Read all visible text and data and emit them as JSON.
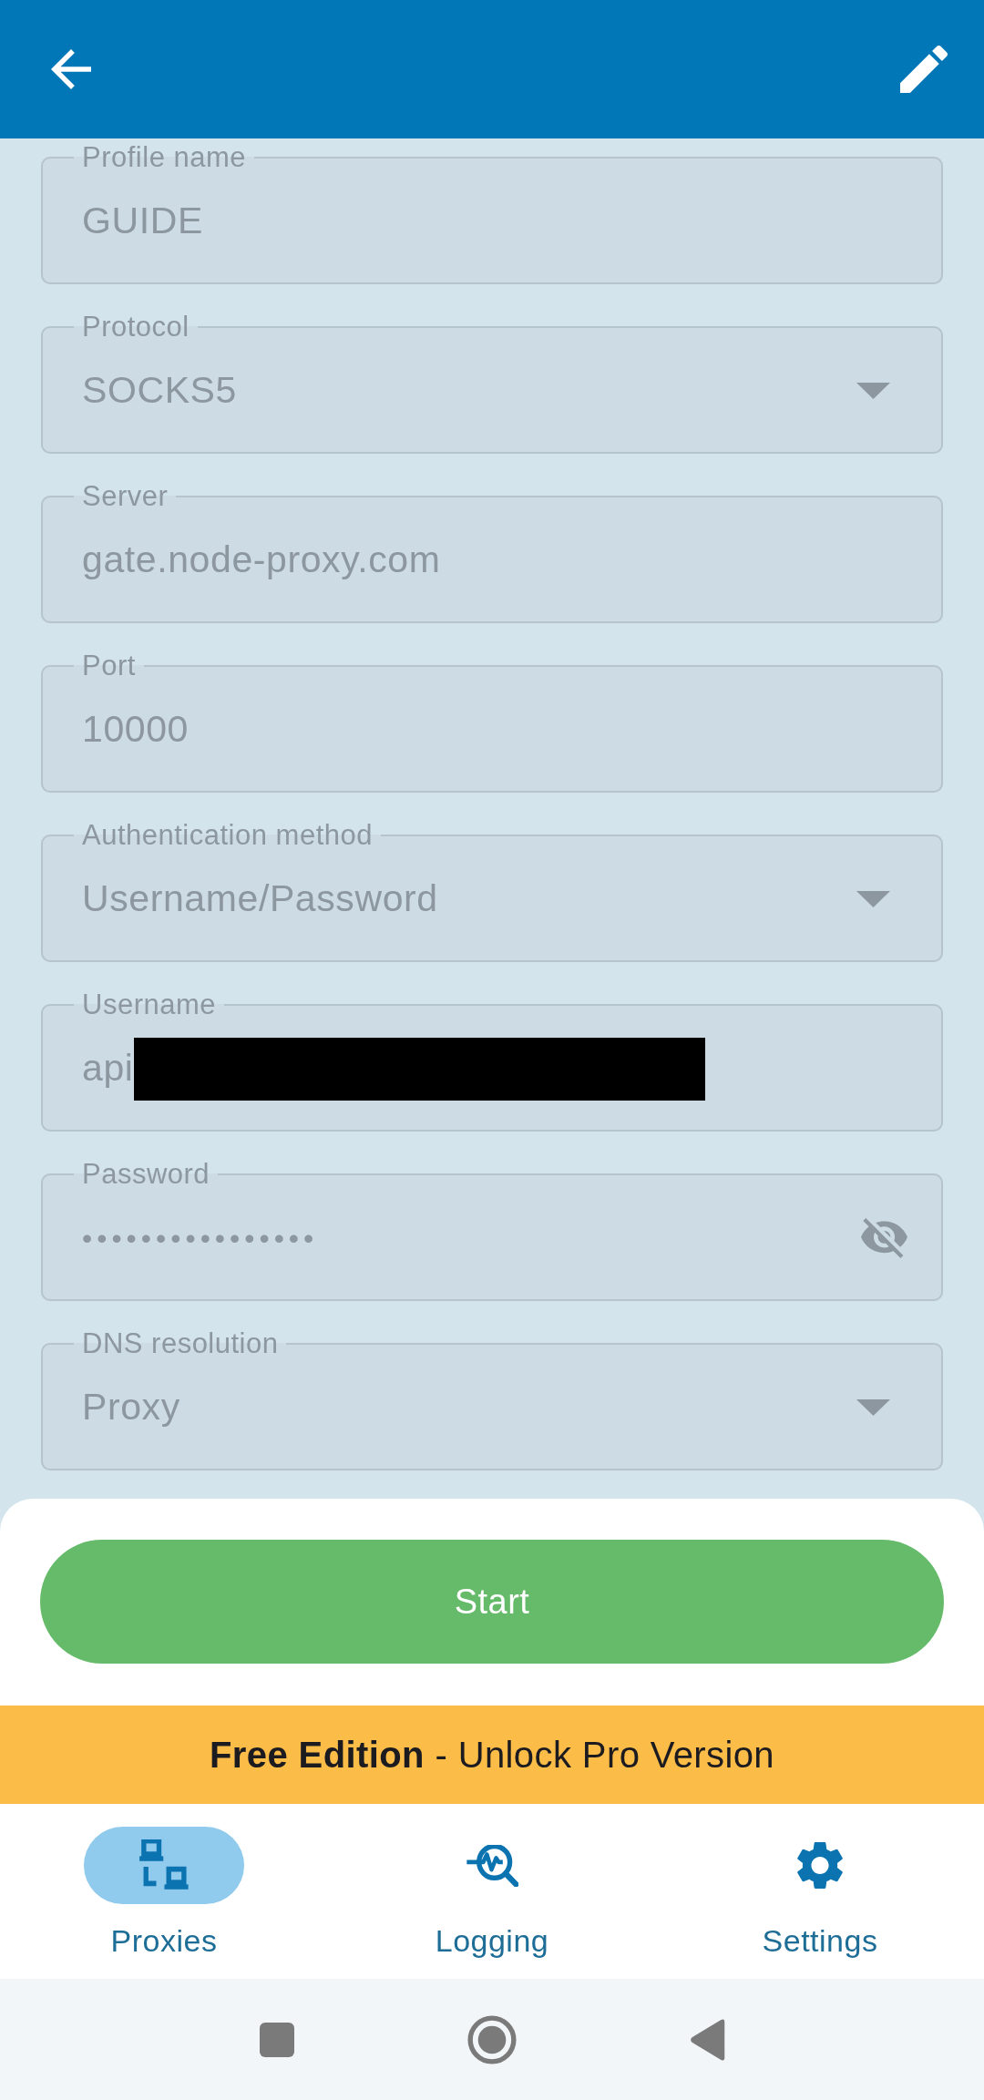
{
  "fields": [
    {
      "label": "Profile name",
      "value": "GUIDE",
      "kind": "text",
      "redacted": false
    },
    {
      "label": "Protocol",
      "value": "SOCKS5",
      "kind": "dropdown",
      "redacted": false
    },
    {
      "label": "Server",
      "value": "gate.node-proxy.com",
      "kind": "text",
      "redacted": false
    },
    {
      "label": "Port",
      "value": "10000",
      "kind": "text",
      "redacted": false
    },
    {
      "label": "Authentication method",
      "value": "Username/Password",
      "kind": "dropdown",
      "redacted": false
    },
    {
      "label": "Username",
      "value": "api",
      "kind": "text",
      "redacted": true
    },
    {
      "label": "Password",
      "value": "••••••••••••••••",
      "kind": "password",
      "redacted": false
    },
    {
      "label": "DNS resolution",
      "value": "Proxy",
      "kind": "dropdown",
      "redacted": false
    }
  ],
  "start_button": {
    "label": "Start"
  },
  "banner": {
    "text": "**Free Edition** - Unlock Pro Version"
  },
  "bottom_nav": [
    {
      "label": "Proxies",
      "selected": true
    },
    {
      "label": "Logging",
      "selected": false
    },
    {
      "label": "Settings",
      "selected": false
    }
  ]
}
